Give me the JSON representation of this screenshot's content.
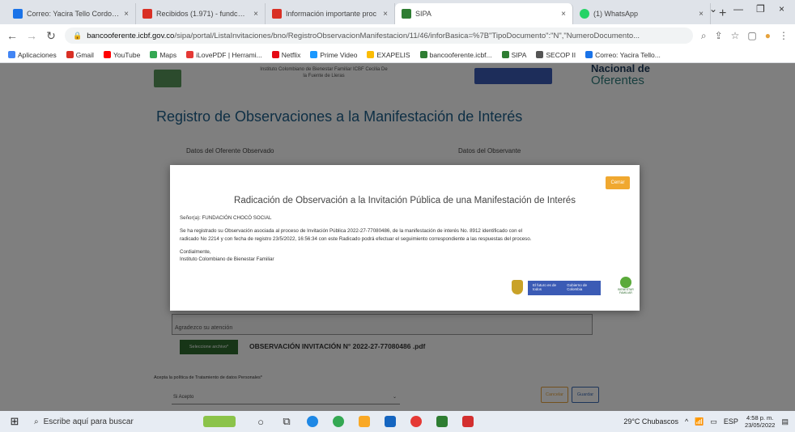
{
  "browser": {
    "tabs": [
      {
        "label": "Correo: Yacira Tello Cordoba",
        "close": "×",
        "color": "#1a73e8"
      },
      {
        "label": "Recibidos (1.971) - fundchoc",
        "close": "×",
        "color": "#d93025"
      },
      {
        "label": "Información importante proc",
        "close": "×",
        "color": "#d93025"
      },
      {
        "label": "SIPA",
        "close": "×",
        "color": "#2e7d32",
        "active": true
      },
      {
        "label": "(1) WhatsApp",
        "close": "×",
        "color": "#25d366"
      }
    ],
    "new_tab": "+",
    "window_controls": {
      "dropdown": "⌄",
      "minimize": "—",
      "maximize": "❐",
      "close": "×"
    },
    "url_host": "bancooferente.icbf.gov.co",
    "url_path": "/sipa/portal/ListaInvitaciones/bno/RegistroObservacionManifestacion/11/46/inforBasica=%7B\"TipoDocumento\":\"N\",\"NumeroDocumento...",
    "bookmarks": [
      {
        "label": "Aplicaciones",
        "color": "#4285f4"
      },
      {
        "label": "Gmail",
        "color": "#d93025"
      },
      {
        "label": "YouTube",
        "color": "#ff0000"
      },
      {
        "label": "Maps",
        "color": "#34a853"
      },
      {
        "label": "iLovePDF | Herrami...",
        "color": "#e53935"
      },
      {
        "label": "Netflix",
        "color": "#e50914"
      },
      {
        "label": "Prime Video",
        "color": "#1a98ff"
      },
      {
        "label": "EXAPELIS",
        "color": "#fbbc04"
      },
      {
        "label": "bancooferente.icbf...",
        "color": "#2e7d32"
      },
      {
        "label": "SIPA",
        "color": "#2e7d32"
      },
      {
        "label": "SECOP II",
        "color": "#555555"
      },
      {
        "label": "Correo: Yacira Tello...",
        "color": "#1a73e8"
      }
    ]
  },
  "page": {
    "header_text": "Instituto Colombiano de Bienestar Familiar ICBF Cecilia De la Fuente de Lleras",
    "oferentes_line1": "Nacional de",
    "oferentes_line2": "Oferentes",
    "title": "Registro de Observaciones a la Manifestación de Interés",
    "left_subhead": "Datos del Oferente Observado",
    "right_subhead": "Datos del Observante",
    "textarea_text": "Agradezco su atención",
    "attach_button": "Seleccione archivo*",
    "attach_file": "OBSERVACIÓN INVITACIÓN N° 2022-27-77080486 .pdf",
    "policy_label": "Acepta la política de Tratamiento de datos Personales*",
    "policy_value": "Si Acepto",
    "btn_cancel": "Cancelar",
    "btn_save": "Guardar"
  },
  "modal": {
    "close_label": "Cerrar",
    "title": "Radicación de Observación a la Invitación Pública de una Manifestación de Interés",
    "salutation": "Señor(a): FUNDACIÓN CHOCÓ SOCIAL",
    "body_line1": "Se ha registrado su Observación asociada al proceso de Invitación Pública 2022-27-77080486, de la manifestación de interés No. 8912 identificado con el",
    "body_line2": "radicado No 2214 y con fecha de registro 23/5/2022, 16:56:34 con este Radicado podrá efectuar el seguimiento correspondiente a las respuestas del proceso.",
    "closing": "Cordialmente,",
    "signature": "Instituto Colombiano de Bienestar Familiar",
    "gov_logo_text": "El futuro es de todos",
    "gov_logo_text2": "Gobierno de Colombia",
    "icbf_text": "BIENESTAR FAMILIAR"
  },
  "taskbar": {
    "search_placeholder": "Escribe aquí para buscar",
    "weather": "29°C Chubascos",
    "language": "ESP",
    "time": "4:58 p. m.",
    "date": "23/05/2022"
  }
}
